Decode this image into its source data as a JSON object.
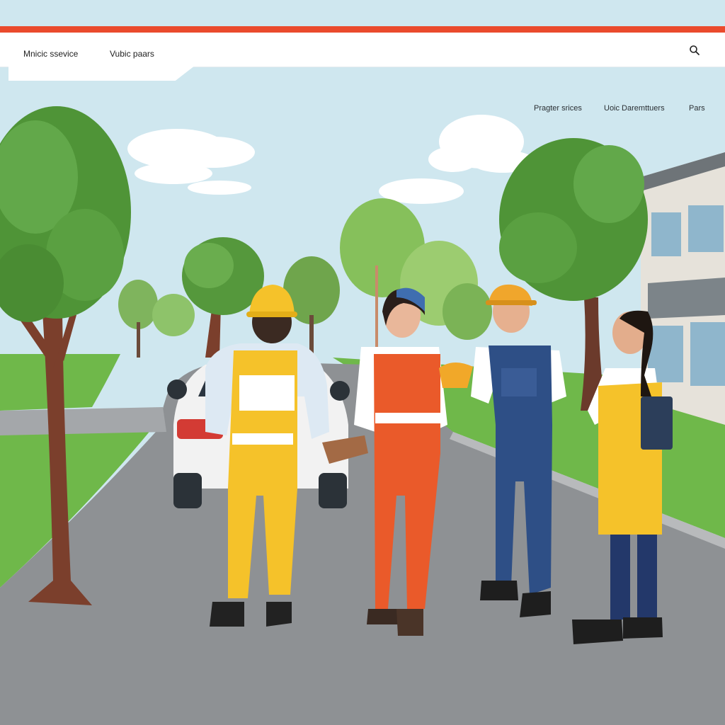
{
  "header": {
    "nav_primary": [
      "Mnicic ssevice",
      "Vubic paars"
    ],
    "search_icon": "search-icon"
  },
  "secondary_nav": [
    "Pragter srices",
    "Uoic Daremttuers",
    "Pars"
  ],
  "colors": {
    "accent": "#ea4a2c",
    "sky": "#cfe7ef",
    "road": "#8e9194",
    "grass": "#6fb84a"
  }
}
